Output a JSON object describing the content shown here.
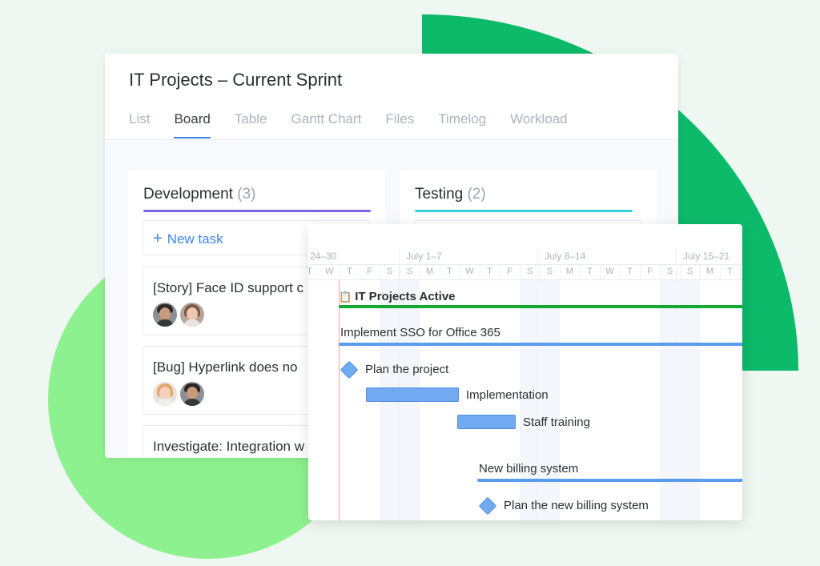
{
  "board": {
    "title": "IT Projects – Current Sprint",
    "tabs": [
      {
        "label": "List",
        "active": false
      },
      {
        "label": "Board",
        "active": true
      },
      {
        "label": "Table",
        "active": false
      },
      {
        "label": "Gantt Chart",
        "active": false
      },
      {
        "label": "Files",
        "active": false
      },
      {
        "label": "Timelog",
        "active": false
      },
      {
        "label": "Workload",
        "active": false
      }
    ],
    "columns": [
      {
        "name": "Development",
        "count": "(3)",
        "new_task": "New task",
        "tasks": [
          {
            "title": "[Story] Face ID support c",
            "avatars": [
              "man-avatar",
              "woman-avatar"
            ]
          },
          {
            "title": "[Bug] Hyperlink does no",
            "avatars": [
              "blonde-avatar",
              "man-avatar"
            ]
          },
          {
            "title": "Investigate: Integration w",
            "avatars": []
          }
        ]
      },
      {
        "name": "Testing",
        "count": "(2)"
      }
    ]
  },
  "gantt": {
    "weeks": [
      "24–30",
      "July 1–7",
      "July 8–14",
      "July 15–21"
    ],
    "days": [
      "T",
      "W",
      "T",
      "F",
      "S",
      "S",
      "M",
      "T",
      "W",
      "T",
      "F",
      "S",
      "S",
      "M",
      "T",
      "W",
      "T",
      "F",
      "S",
      "S",
      "M",
      "T",
      "W"
    ],
    "items": [
      {
        "label": "IT Projects Active",
        "kind": "project",
        "icon": "clipboard-icon"
      },
      {
        "label": "Implement SSO for Office 365",
        "kind": "group"
      },
      {
        "label": "Plan the project",
        "kind": "milestone"
      },
      {
        "label": "Implementation",
        "kind": "task"
      },
      {
        "label": "Staff training",
        "kind": "task"
      },
      {
        "label": "New billing system",
        "kind": "group"
      },
      {
        "label": "Plan the new billing system",
        "kind": "milestone"
      }
    ]
  },
  "colors": {
    "accent_blue": "#3f85e6",
    "project_bar": "#12a832",
    "task_bar": "#72aaf1",
    "dev_column": "#7b61e3",
    "test_column": "#34d1dc",
    "blob_dark": "#0dba6a",
    "blob_light": "#8ef18f"
  }
}
